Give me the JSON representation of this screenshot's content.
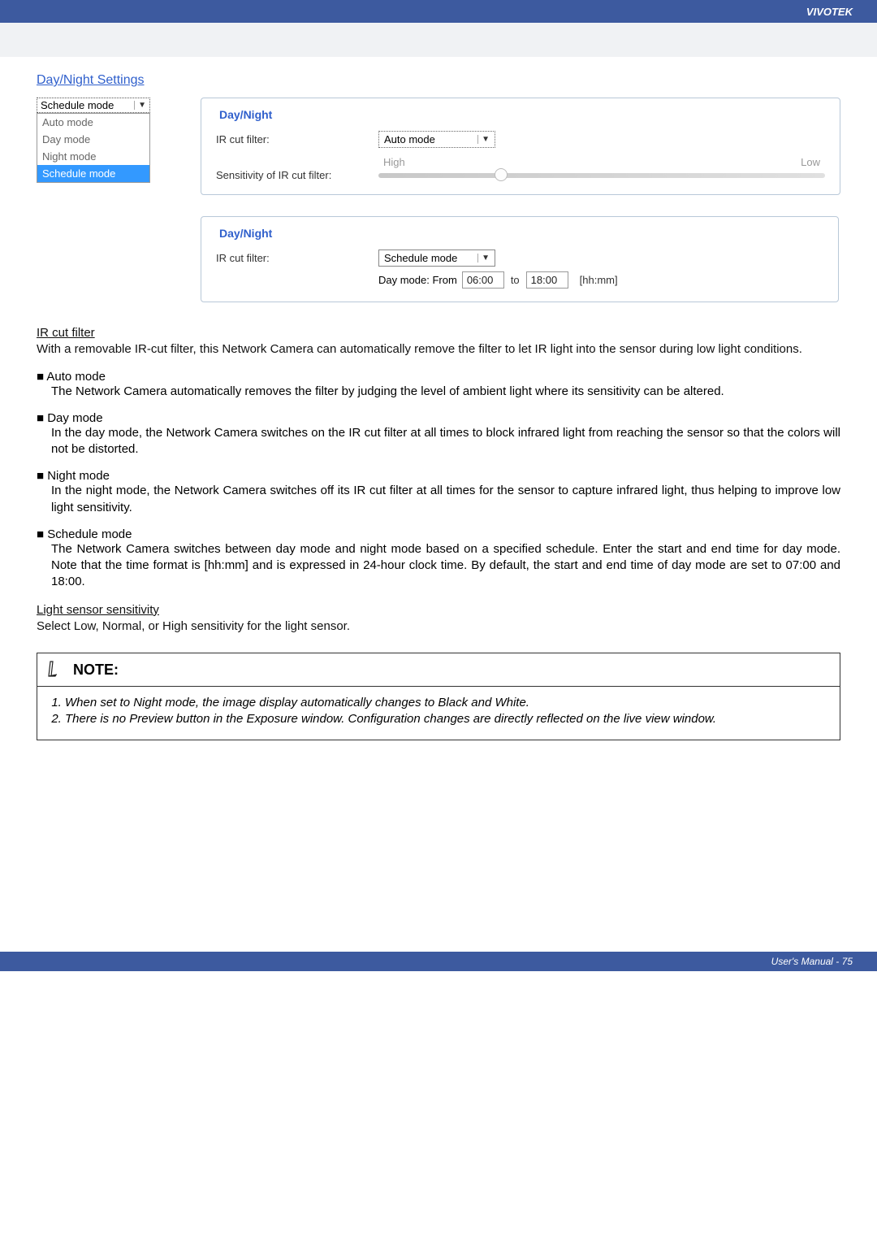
{
  "header": {
    "brand": "VIVOTEK"
  },
  "section_title": "Day/Night Settings",
  "mode_dropdown": {
    "selected": "Schedule mode",
    "options": [
      "Auto mode",
      "Day mode",
      "Night mode",
      "Schedule mode"
    ]
  },
  "panel1": {
    "legend": "Day/Night",
    "ir_label": "IR cut filter:",
    "ir_value": "Auto mode",
    "sens_label": "Sensitivity of IR cut filter:",
    "high": "High",
    "low": "Low"
  },
  "panel2": {
    "legend": "Day/Night",
    "ir_label": "IR cut filter:",
    "ir_value": "Schedule mode",
    "sched_label": "Day mode: From",
    "from_time": "06:00",
    "to_label": "to",
    "to_time": "18:00",
    "unit": "[hh:mm]"
  },
  "ircut": {
    "heading": "IR cut filter",
    "text": "With a removable IR-cut filter, this Network Camera can automatically remove the filter to let IR light into the sensor during low light conditions."
  },
  "auto": {
    "heading": "■ Auto mode",
    "text": "The Network Camera automatically removes the filter by judging the level of ambient light where its sensitivity can be altered."
  },
  "day": {
    "heading": "■ Day mode",
    "text": "In the day mode, the Network Camera switches on the IR cut filter at all times to block infrared light from reaching the sensor so that the colors will not be distorted."
  },
  "night": {
    "heading": "■ Night mode",
    "text": "In the night mode, the Network Camera switches off its IR cut filter at all times for the sensor to capture infrared light, thus helping to improve low light sensitivity."
  },
  "schedule": {
    "heading": "■ Schedule mode",
    "text": "The Network Camera switches between day mode and night mode based on a specified schedule. Enter the start and end time for day mode. Note that the time format is [hh:mm] and is expressed in 24-hour clock time. By default, the start and end time of day mode are set to 07:00 and 18:00."
  },
  "lightsensor": {
    "heading": "Light sensor sensitivity",
    "text": "Select Low, Normal, or High sensitivity for the light sensor."
  },
  "note": {
    "title": "NOTE:",
    "item1": "When set to Night mode, the image display automatically changes to Black and White.",
    "item2": "There is no Preview button in the Exposure window. Configuration changes are directly reflected on the live view window."
  },
  "footer": {
    "text": "User's Manual - 75"
  }
}
